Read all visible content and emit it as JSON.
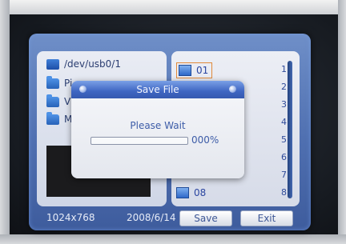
{
  "browser": {
    "path": "/dev/usb0/1",
    "folders": [
      "Pi...",
      "V",
      "M"
    ]
  },
  "files": {
    "items": [
      "01",
      "08"
    ],
    "page_numbers": [
      "1",
      "2",
      "3",
      "4",
      "5",
      "6",
      "7",
      "8"
    ]
  },
  "status": {
    "resolution": "1024x768",
    "date": "2008/6/14"
  },
  "buttons": {
    "save_label": "Save",
    "exit_label": "Exit"
  },
  "dialog": {
    "title": "Save File",
    "message": "Please Wait",
    "percent_text": "000%",
    "progress_fraction": 0
  },
  "colors": {
    "panel_blue": "#4f6fb0",
    "highlight_orange": "#e08a3a"
  }
}
